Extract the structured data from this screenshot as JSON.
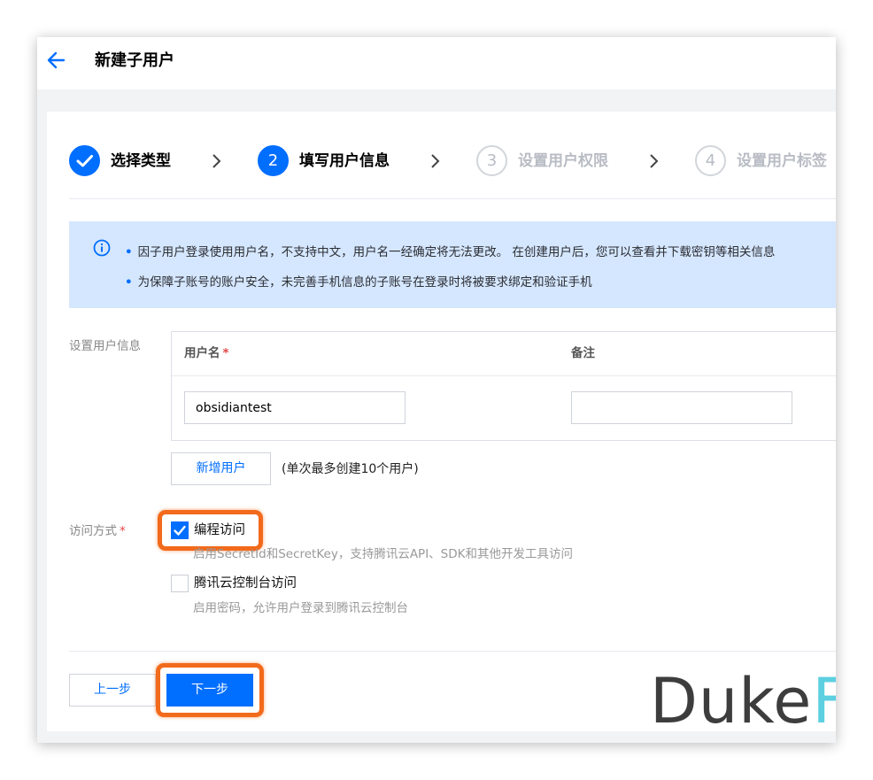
{
  "header": {
    "title": "新建子用户"
  },
  "steps": [
    {
      "number": "1",
      "label": "选择类型",
      "state": "done"
    },
    {
      "number": "2",
      "label": "填写用户信息",
      "state": "active"
    },
    {
      "number": "3",
      "label": "设置用户权限",
      "state": "todo"
    },
    {
      "number": "4",
      "label": "设置用户标签",
      "state": "todo"
    }
  ],
  "notice": {
    "lines": [
      "因子用户登录使用用户名，不支持中文，用户名一经确定将无法更改。 在创建用户后，您可以查看并下载密钥等相关信息",
      "为保障子账号的账户安全，未完善手机信息的子账号在登录时将被要求绑定和验证手机"
    ]
  },
  "user_info": {
    "label": "设置用户信息",
    "columns": {
      "username": "用户名",
      "remark": "备注"
    },
    "rows": [
      {
        "username": "obsidiantest",
        "remark": ""
      }
    ],
    "add_button": "新增用户",
    "add_hint": "(单次最多创建10个用户)"
  },
  "access": {
    "label": "访问方式",
    "options": [
      {
        "label": "编程访问",
        "checked": true,
        "description": "启用SecretId和SecretKey，支持腾讯云API、SDK和其他开发工具访问"
      },
      {
        "label": "腾讯云控制台访问",
        "checked": false,
        "description": "启用密码，允许用户登录到腾讯云控制台"
      }
    ]
  },
  "footer": {
    "prev": "上一步",
    "next": "下一步"
  },
  "watermark": {
    "part1": "Duke",
    "part2": "Fox"
  },
  "colors": {
    "primary": "#006eff",
    "highlight": "#f26a1b",
    "notice_bg": "#d5e7ff",
    "required": "#e54545"
  }
}
